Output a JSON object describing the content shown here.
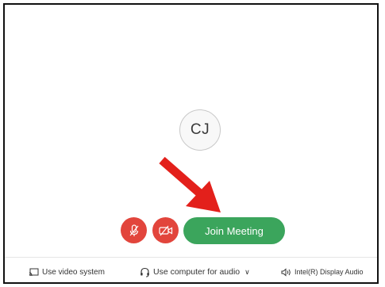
{
  "avatar": {
    "initials": "CJ"
  },
  "controls": {
    "mute_icon": "mic-off-icon",
    "video_icon": "video-off-icon",
    "join_label": "Join Meeting"
  },
  "bottom_bar": {
    "video_system_label": "Use video system",
    "audio_label": "Use computer for audio",
    "speaker_label": "Intel(R) Display Audio"
  },
  "colors": {
    "join": "#3ba55c",
    "media_off": "#e2453c",
    "annotation_arrow": "#e3201b"
  }
}
